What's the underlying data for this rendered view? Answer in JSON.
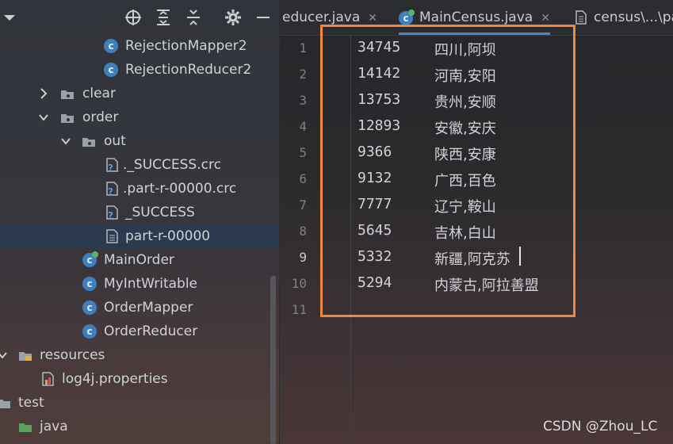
{
  "tree": {
    "items": [
      {
        "label": "RejectionMapper2",
        "type": "class"
      },
      {
        "label": "RejectionReducer2",
        "type": "class"
      },
      {
        "label": "clear",
        "type": "folder",
        "expanded": false
      },
      {
        "label": "order",
        "type": "folder",
        "expanded": true
      },
      {
        "label": "out",
        "type": "folder",
        "expanded": true
      },
      {
        "label": "._SUCCESS.crc",
        "type": "unknown-file"
      },
      {
        "label": ".part-r-00000.crc",
        "type": "unknown-file"
      },
      {
        "label": "_SUCCESS",
        "type": "unknown-file"
      },
      {
        "label": "part-r-00000",
        "type": "text-file",
        "selected": true
      },
      {
        "label": "MainOrder",
        "type": "main-class"
      },
      {
        "label": "MyIntWritable",
        "type": "class"
      },
      {
        "label": "OrderMapper",
        "type": "class"
      },
      {
        "label": "OrderReducer",
        "type": "class"
      },
      {
        "label": "resources",
        "type": "resources-folder",
        "expanded": true
      },
      {
        "label": "log4j.properties",
        "type": "properties-file"
      },
      {
        "label": "test",
        "type": "folder"
      },
      {
        "label": "java",
        "type": "source-folder"
      }
    ]
  },
  "editor": {
    "tabs": [
      {
        "label": "educer.java",
        "icon": "none",
        "active": false
      },
      {
        "label": "MainCensus.java",
        "icon": "main-class",
        "active": true
      },
      {
        "label": "census\\...\\pa",
        "icon": "text-file",
        "active": false
      }
    ],
    "lines": [
      {
        "n": "1",
        "num": "34745",
        "text": "四川,阿坝"
      },
      {
        "n": "2",
        "num": "14142",
        "text": "河南,安阳"
      },
      {
        "n": "3",
        "num": "13753",
        "text": "贵州,安顺"
      },
      {
        "n": "4",
        "num": "12893",
        "text": "安徽,安庆"
      },
      {
        "n": "5",
        "num": "9366",
        "text": "陕西,安康"
      },
      {
        "n": "6",
        "num": "9132",
        "text": "广西,百色"
      },
      {
        "n": "7",
        "num": "7777",
        "text": "辽宁,鞍山"
      },
      {
        "n": "8",
        "num": "5645",
        "text": "吉林,白山"
      },
      {
        "n": "9",
        "num": "5332",
        "text": "新疆,阿克苏"
      },
      {
        "n": "10",
        "num": "5294",
        "text": "内蒙古,阿拉善盟"
      },
      {
        "n": "11",
        "num": "",
        "text": ""
      }
    ],
    "current_line": "9",
    "highlight_color": "#f0883e"
  },
  "watermark": "CSDN @Zhou_LC"
}
